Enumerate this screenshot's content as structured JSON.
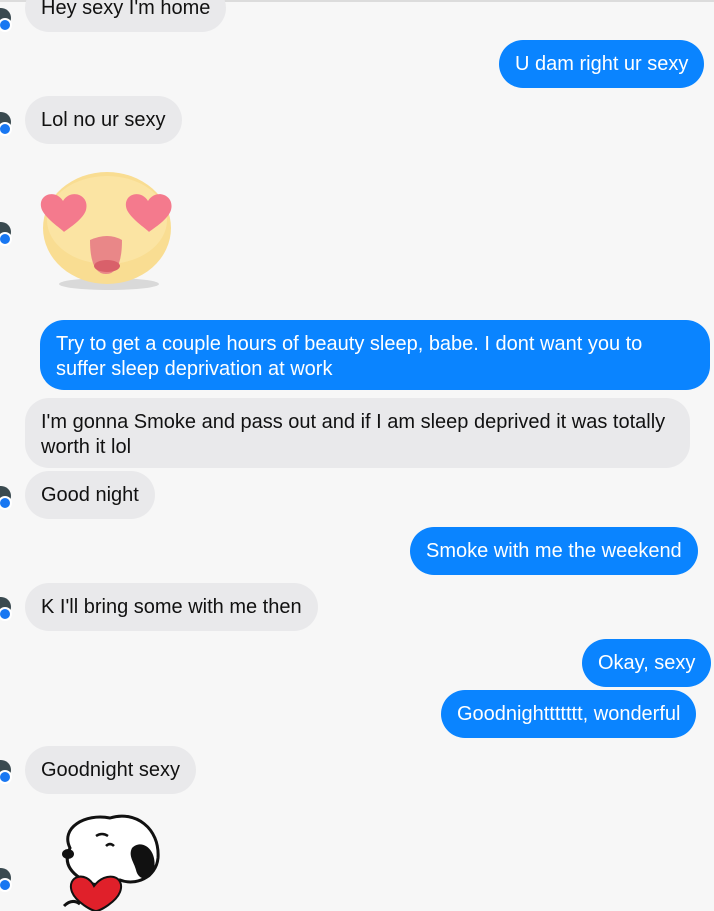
{
  "messages": [
    {
      "text": "Hey sexy I'm home",
      "dir": "in"
    },
    {
      "text": "U dam right ur sexy",
      "dir": "out"
    },
    {
      "text": "Lol no ur sexy",
      "dir": "in"
    },
    {
      "text": "Try to get a couple hours of beauty sleep, babe. I dont want you to suffer sleep deprivation at work",
      "dir": "out"
    },
    {
      "text": "I'm gonna Smoke and pass out and if I am sleep deprived it was totally worth it lol",
      "dir": "in"
    },
    {
      "text": "Good night",
      "dir": "in"
    },
    {
      "text": "Smoke with me the weekend",
      "dir": "out"
    },
    {
      "text": "K I'll bring some with me then",
      "dir": "in"
    },
    {
      "text": "Okay, sexy",
      "dir": "out"
    },
    {
      "text": "Goodnighttttttt, wonderful",
      "dir": "out"
    },
    {
      "text": "Goodnight sexy",
      "dir": "in"
    }
  ],
  "stickers": [
    {
      "icon": "heart-eyes-emoji-icon"
    },
    {
      "icon": "snoopy-heart-sticker-icon"
    }
  ],
  "colors": {
    "outgoing_bubble": "#0a84ff",
    "incoming_bubble": "#e9e9eb",
    "background": "#f7f7f7"
  }
}
